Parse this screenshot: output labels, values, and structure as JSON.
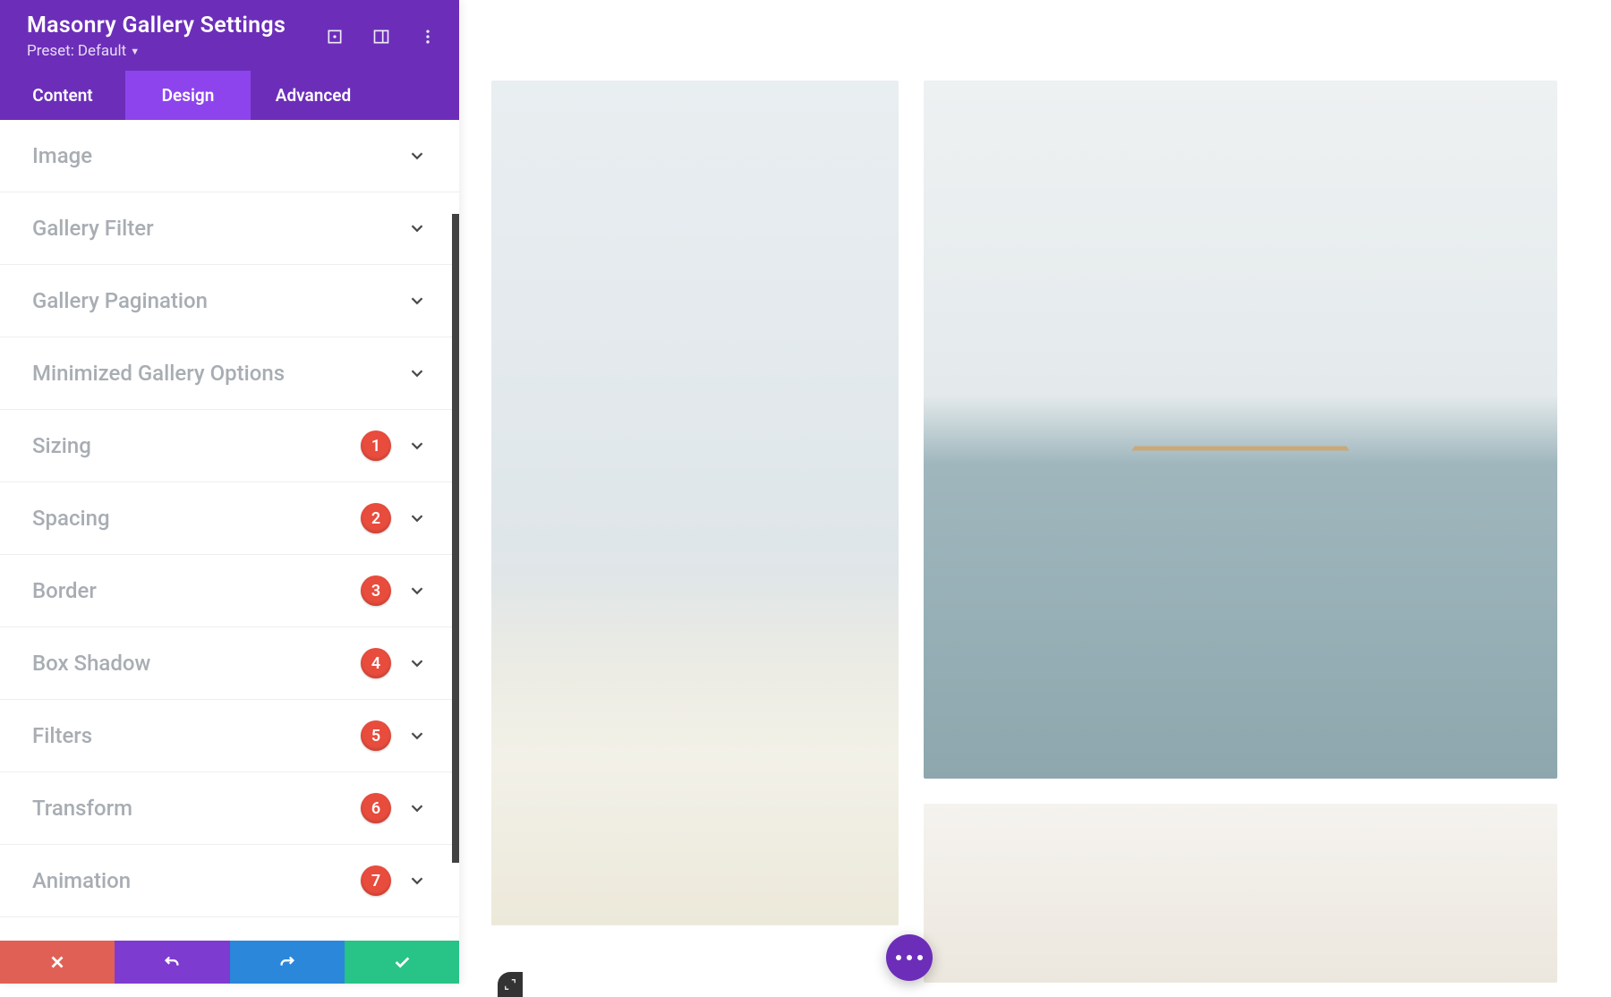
{
  "header": {
    "title": "Masonry Gallery Settings",
    "preset_prefix": "Preset:",
    "preset_value": "Default"
  },
  "tabs": {
    "content": "Content",
    "design": "Design",
    "advanced": "Advanced",
    "active": "design"
  },
  "sections": [
    {
      "label": "Image",
      "badge": null
    },
    {
      "label": "Gallery Filter",
      "badge": null
    },
    {
      "label": "Gallery Pagination",
      "badge": null
    },
    {
      "label": "Minimized Gallery Options",
      "badge": null
    },
    {
      "label": "Sizing",
      "badge": "1"
    },
    {
      "label": "Spacing",
      "badge": "2"
    },
    {
      "label": "Border",
      "badge": "3"
    },
    {
      "label": "Box Shadow",
      "badge": "4"
    },
    {
      "label": "Filters",
      "badge": "5"
    },
    {
      "label": "Transform",
      "badge": "6"
    },
    {
      "label": "Animation",
      "badge": "7"
    }
  ],
  "colors": {
    "header_purple": "#6c2eb9",
    "tab_active_purple": "#8e44ec",
    "badge_red": "#e84c3d",
    "footer_red": "#e06055",
    "footer_purple": "#7e3bd0",
    "footer_blue": "#2b87da",
    "footer_green": "#28c386"
  }
}
